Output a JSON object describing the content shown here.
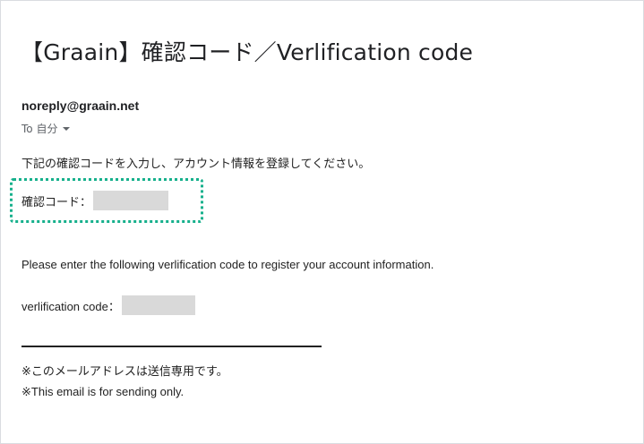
{
  "email": {
    "subject": "【Graain】確認コード／Verlification code",
    "sender": "noreply@graain.net",
    "recipient": "To 自分",
    "body": {
      "jp_intro": "下記の確認コードを入力し、アカウント情報を登録してください。",
      "jp_code_label": "確認コード：",
      "en_intro": "Please enter the following verlification code to register your account information.",
      "en_code_label": "verlification code：",
      "note_jp": "※このメールアドレスは送信専用です。",
      "note_en": "※This email is for sending only."
    }
  },
  "colors": {
    "highlight": "#16b08c",
    "redaction": "#d9d9d9"
  },
  "icons": {
    "recipient_toggle": "chevron-down-icon"
  }
}
